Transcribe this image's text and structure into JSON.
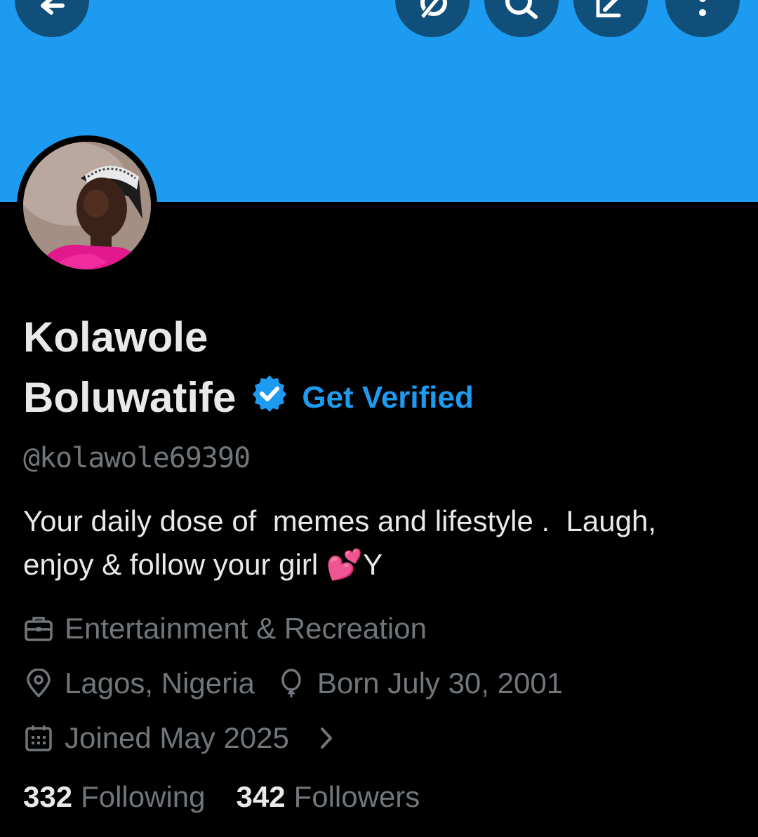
{
  "header": {
    "buttons": [
      {
        "name": "back-button",
        "icon": "arrow-left-icon"
      },
      {
        "name": "grok-button",
        "icon": "grok-icon"
      },
      {
        "name": "search-button",
        "icon": "search-icon"
      },
      {
        "name": "edit-button",
        "icon": "edit-icon"
      },
      {
        "name": "more-button",
        "icon": "more-vertical-icon"
      }
    ],
    "banner_color": "#1d9bf0"
  },
  "profile": {
    "name_line1": "Kolawole",
    "name_line2": "Boluwatife",
    "get_verified": "Get Verified",
    "handle": "@kolawole69390",
    "bio": "Your daily dose of  memes and lifestyle .  Laugh,\nenjoy & follow your girl 💕Y",
    "category": "Entertainment & Recreation",
    "location": "Lagos, Nigeria",
    "birthday": "Born July 30, 2001",
    "joined": "Joined May 2025",
    "following_count": "332",
    "following_label": "Following",
    "followers_count": "342",
    "followers_label": "Followers"
  },
  "colors": {
    "accent": "#1d9bf0",
    "background": "#000000",
    "primary_text": "#e7e9ea",
    "secondary_text": "#71767b"
  }
}
